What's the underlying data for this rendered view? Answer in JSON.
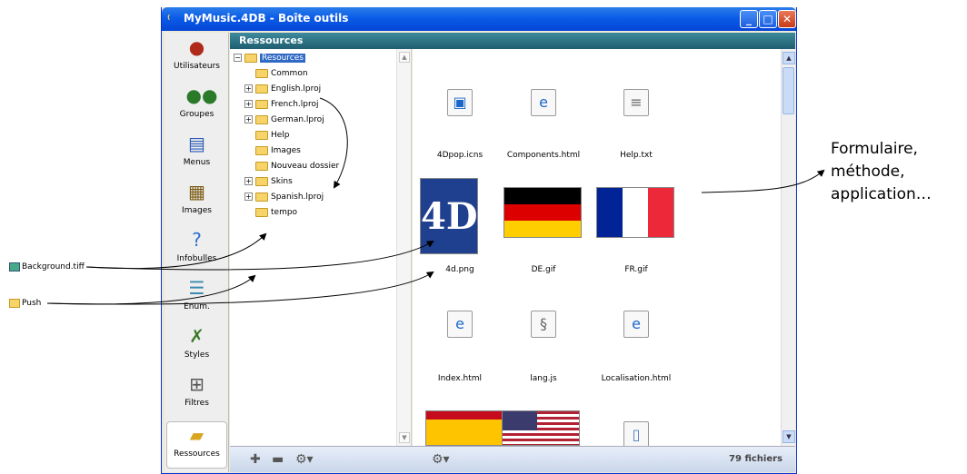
{
  "window": {
    "title": "MyMusic.4DB - Boîte outils"
  },
  "toolbar": {
    "items": [
      {
        "label": "Utilisateurs",
        "icon": "user-icon"
      },
      {
        "label": "Groupes",
        "icon": "group-icon"
      },
      {
        "label": "Menus",
        "icon": "menu-icon"
      },
      {
        "label": "Images",
        "icon": "images-icon"
      },
      {
        "label": "Infobulles",
        "icon": "tooltip-icon"
      },
      {
        "label": "Enum.",
        "icon": "list-icon"
      },
      {
        "label": "Styles",
        "icon": "styles-icon"
      },
      {
        "label": "Filtres",
        "icon": "filter-icon"
      },
      {
        "label": "Ressources",
        "icon": "folder-icon",
        "selected": true
      }
    ]
  },
  "pane": {
    "header": "Ressources"
  },
  "tree": {
    "nodes": [
      {
        "label": "Resources",
        "expanded": true,
        "selected": true
      },
      {
        "label": "Common"
      },
      {
        "label": "English.lproj",
        "has_children": true
      },
      {
        "label": "French.lproj",
        "has_children": true
      },
      {
        "label": "German.lproj",
        "has_children": true
      },
      {
        "label": "Help"
      },
      {
        "label": "Images"
      },
      {
        "label": "Nouveau dossier"
      },
      {
        "label": "Skins",
        "has_children": true
      },
      {
        "label": "Spanish.lproj",
        "has_children": true
      },
      {
        "label": "tempo"
      }
    ]
  },
  "files": [
    {
      "name": "4Dpop.icns",
      "icon": "icns-icon"
    },
    {
      "name": "Components.html",
      "icon": "html-icon"
    },
    {
      "name": "Help.txt",
      "icon": "text-icon"
    },
    {
      "name": "4d.png",
      "icon": "4d-logo-icon"
    },
    {
      "name": "DE.gif",
      "icon": "german-flag"
    },
    {
      "name": "FR.gif",
      "icon": "french-flag"
    },
    {
      "name": "Index.html",
      "icon": "html-icon"
    },
    {
      "name": "lang.js",
      "icon": "script-icon"
    },
    {
      "name": "Localisation.html",
      "icon": "html-icon"
    },
    {
      "name": "",
      "icon": "spanish-flag"
    },
    {
      "name": "",
      "icon": "us-flag"
    },
    {
      "name": "",
      "icon": "file-icon"
    }
  ],
  "status": {
    "count": "79 fichiers"
  },
  "annotations": {
    "background_file": "Background.tiff",
    "push_folder": "Push",
    "callout_lines": [
      "Formulaire,",
      "méthode,",
      "application…"
    ]
  },
  "colors": {
    "titlebar": "#0b5ce8",
    "header": "#1f5e70",
    "selection": "#316ac5"
  }
}
